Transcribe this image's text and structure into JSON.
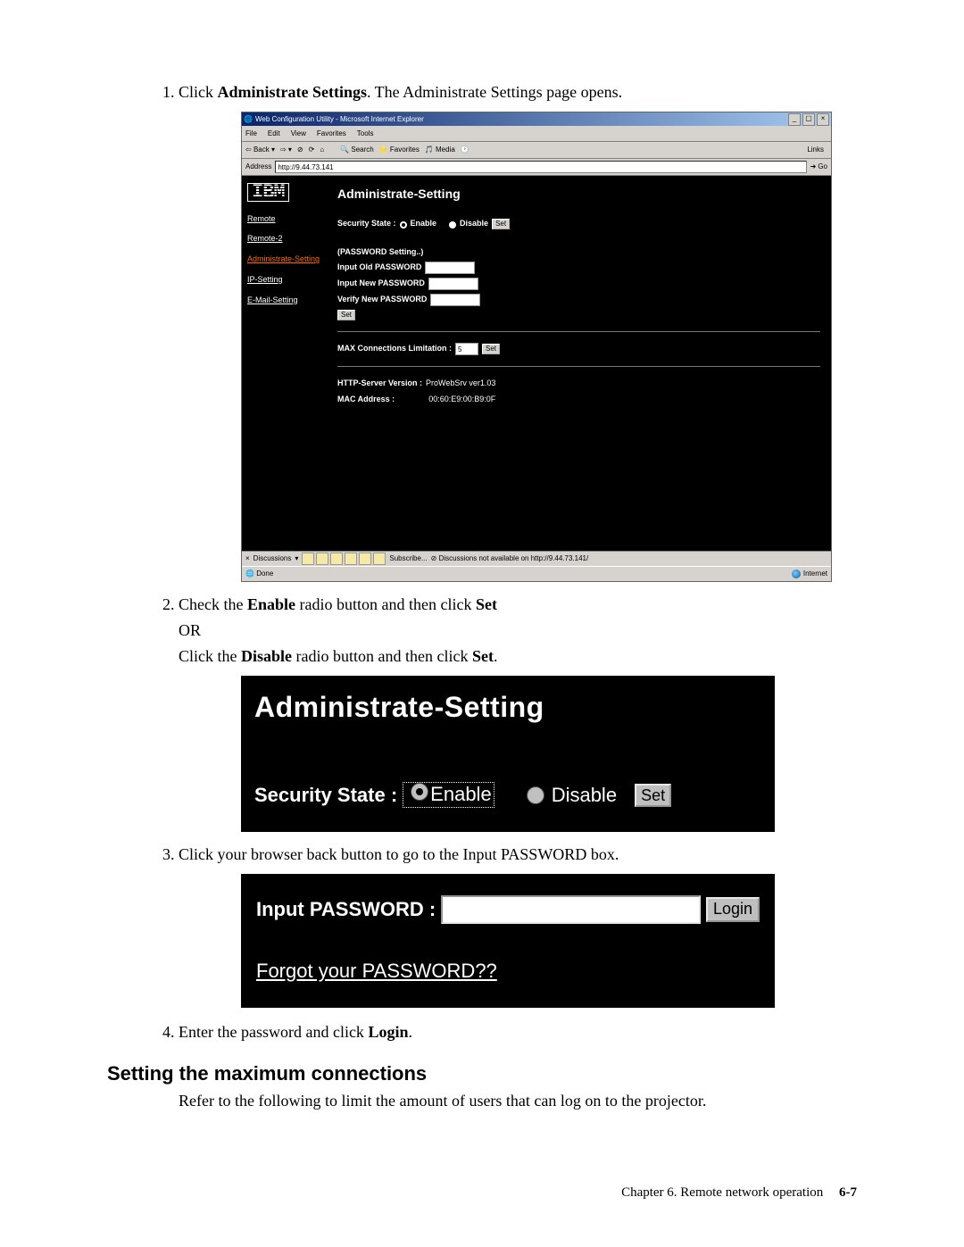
{
  "steps": {
    "s1_pre": "Click ",
    "s1_bold": "Administrate Settings",
    "s1_post": ". The Administrate Settings page opens.",
    "s2_pre": "Check the ",
    "s2_bold1": "Enable",
    "s2_mid": " radio button and then click ",
    "s2_bold2": "Set",
    "s2_or": "OR",
    "s2b_pre": "Click the ",
    "s2b_bold1": "Disable",
    "s2b_mid": " radio button and then click ",
    "s2b_bold2": "Set",
    "s2b_post": ".",
    "s3": "Click your browser back button to go to the Input PASSWORD box.",
    "s4_pre": "Enter the password and click ",
    "s4_bold": "Login",
    "s4_post": "."
  },
  "ie": {
    "title": "Web Configuration Utility - Microsoft Internet Explorer",
    "menus": {
      "file": "File",
      "edit": "Edit",
      "view": "View",
      "favorites": "Favorites",
      "tools": "Tools"
    },
    "toolbar": {
      "back": "Back",
      "search": "Search",
      "favorites": "Favorites",
      "media": "Media"
    },
    "address_label": "Address",
    "address_value": "http://9.44.73.141",
    "go": "Go",
    "links": "Links",
    "sidebar": {
      "logo": "IBM",
      "items": [
        {
          "label": "Remote"
        },
        {
          "label": "Remote-2"
        },
        {
          "label": "Administrate-Setting"
        },
        {
          "label": "IP-Setting"
        },
        {
          "label": "E-Mail-Setting"
        }
      ]
    },
    "main": {
      "heading": "Administrate-Setting",
      "security_label": "Security State :",
      "enable": "Enable",
      "disable": "Disable",
      "set": "Set",
      "pwd_heading": "(PASSWORD Setting..)",
      "old_pwd": "Input Old PASSWORD",
      "new_pwd": "Input New PASSWORD",
      "verify_pwd": "Verify New PASSWORD",
      "max_label": "MAX Connections Limitation :",
      "max_value": "5",
      "http_label": "HTTP-Server Version :",
      "http_value": "ProWebSrv ver1.03",
      "mac_label": "MAC Address :",
      "mac_value": "00:60:E9:00:B9:0F"
    },
    "discuss": {
      "label": "Discussions",
      "subscribe": "Subscribe...",
      "unavailable": "Discussions not available on http://9.44.73.141/"
    },
    "status": {
      "done": "Done",
      "zone": "Internet"
    }
  },
  "fig2": {
    "heading": "Administrate-Setting",
    "security_label": "Security State :",
    "enable": "Enable",
    "disable": "Disable",
    "set": "Set"
  },
  "fig3": {
    "label": "Input PASSWORD :",
    "login": "Login",
    "forgot": "Forgot your PASSWORD??"
  },
  "heading2": "Setting the maximum connections",
  "para2": "Refer to the following to limit the amount of users that can log on to the projector.",
  "footer": {
    "chapter": "Chapter 6. Remote network operation",
    "page": "6-7"
  }
}
